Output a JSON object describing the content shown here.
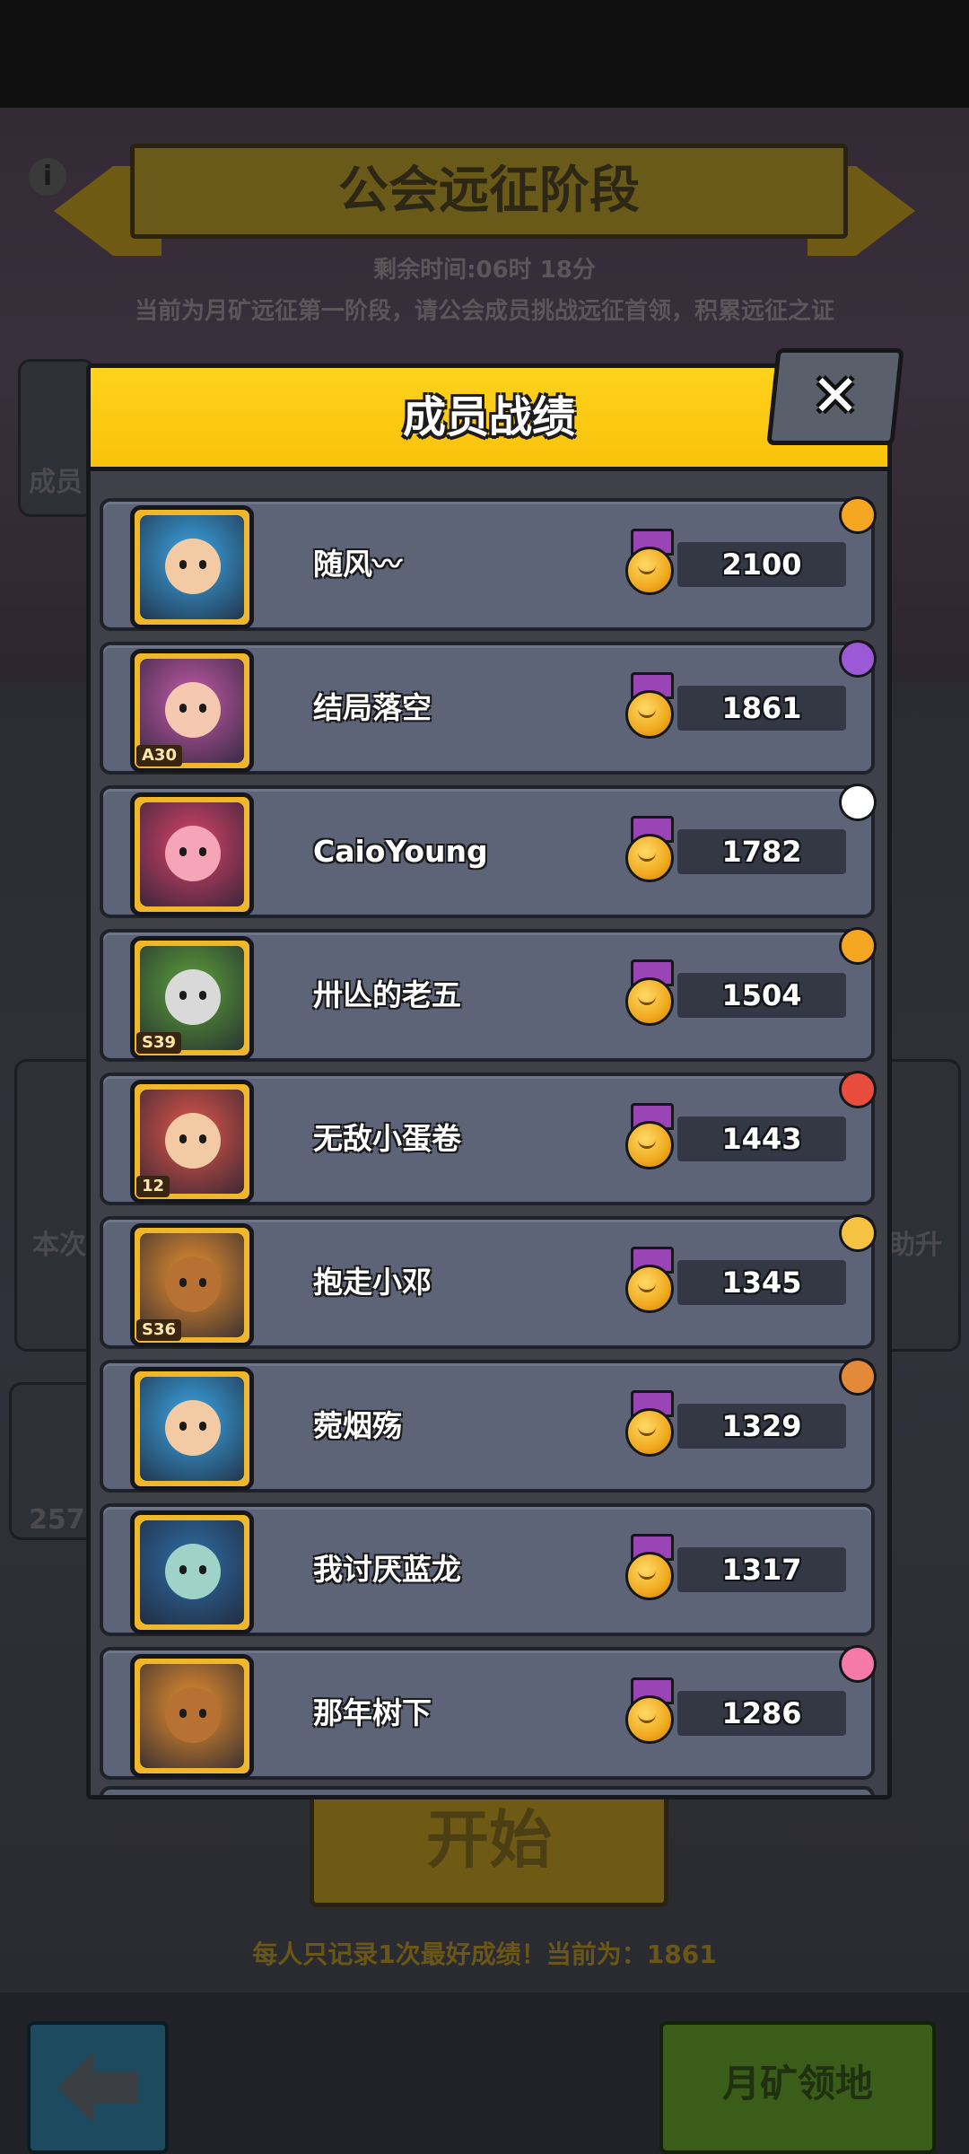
{
  "background": {
    "stage_title": "公会远征阶段",
    "remaining_time": "剩余时间:06时 18分",
    "stage_description": "当前为月矿远征第一阶段，请公会成员挑战远征首领，积累远征之证",
    "side_label_left": "成员",
    "side_label_mid_left": "本次",
    "side_label_mid_right": "助升",
    "side_counter": "257",
    "start_button": "开始",
    "record_note": "每人只记录1次最好成绩！当前为：1861",
    "territory_button": "月矿领地"
  },
  "modal": {
    "title": "成员战绩",
    "close_glyph": "✕",
    "colors": {
      "header": "#f9c20c",
      "row": "#5d6478",
      "medal_ribbon": "#9b44b6"
    },
    "members": [
      {
        "name": "随风〰",
        "score": "2100",
        "badge": "",
        "avatar_color": "#3aa7e6",
        "face_color": "#f2cba5",
        "emblem_color": "#f5a623"
      },
      {
        "name": "结局落空",
        "score": "1861",
        "badge": "A30",
        "avatar_color": "#c45aa8",
        "face_color": "#f4c9b0",
        "emblem_color": "#9b59d6"
      },
      {
        "name": "CaioYoung",
        "score": "1782",
        "badge": "",
        "avatar_color": "#d8436a",
        "face_color": "#f6a5b8",
        "emblem_color": "#ffffff"
      },
      {
        "name": "卅亾的老五",
        "score": "1504",
        "badge": "S39",
        "avatar_color": "#5da03a",
        "face_color": "#d9d9d9",
        "emblem_color": "#f5a623"
      },
      {
        "name": "无敌小蛋卷",
        "score": "1443",
        "badge": "12",
        "avatar_color": "#e0564a",
        "face_color": "#f2cba5",
        "emblem_color": "#e74c3c"
      },
      {
        "name": "抱走小邓",
        "score": "1345",
        "badge": "S36",
        "avatar_color": "#e8902f",
        "face_color": "#b77233",
        "emblem_color": "#f5c242"
      },
      {
        "name": "菀烟殇",
        "score": "1329",
        "badge": "",
        "avatar_color": "#3aa7e6",
        "face_color": "#f2cba5",
        "emblem_color": "#e38a3a"
      },
      {
        "name": "我讨厌蓝龙",
        "score": "1317",
        "badge": "",
        "avatar_color": "#2f6ea5",
        "face_color": "#9fd3c7",
        "emblem_color": ""
      },
      {
        "name": "那年树下",
        "score": "1286",
        "badge": "",
        "avatar_color": "#e8902f",
        "face_color": "#b77233",
        "emblem_color": "#f57aa8"
      }
    ]
  }
}
